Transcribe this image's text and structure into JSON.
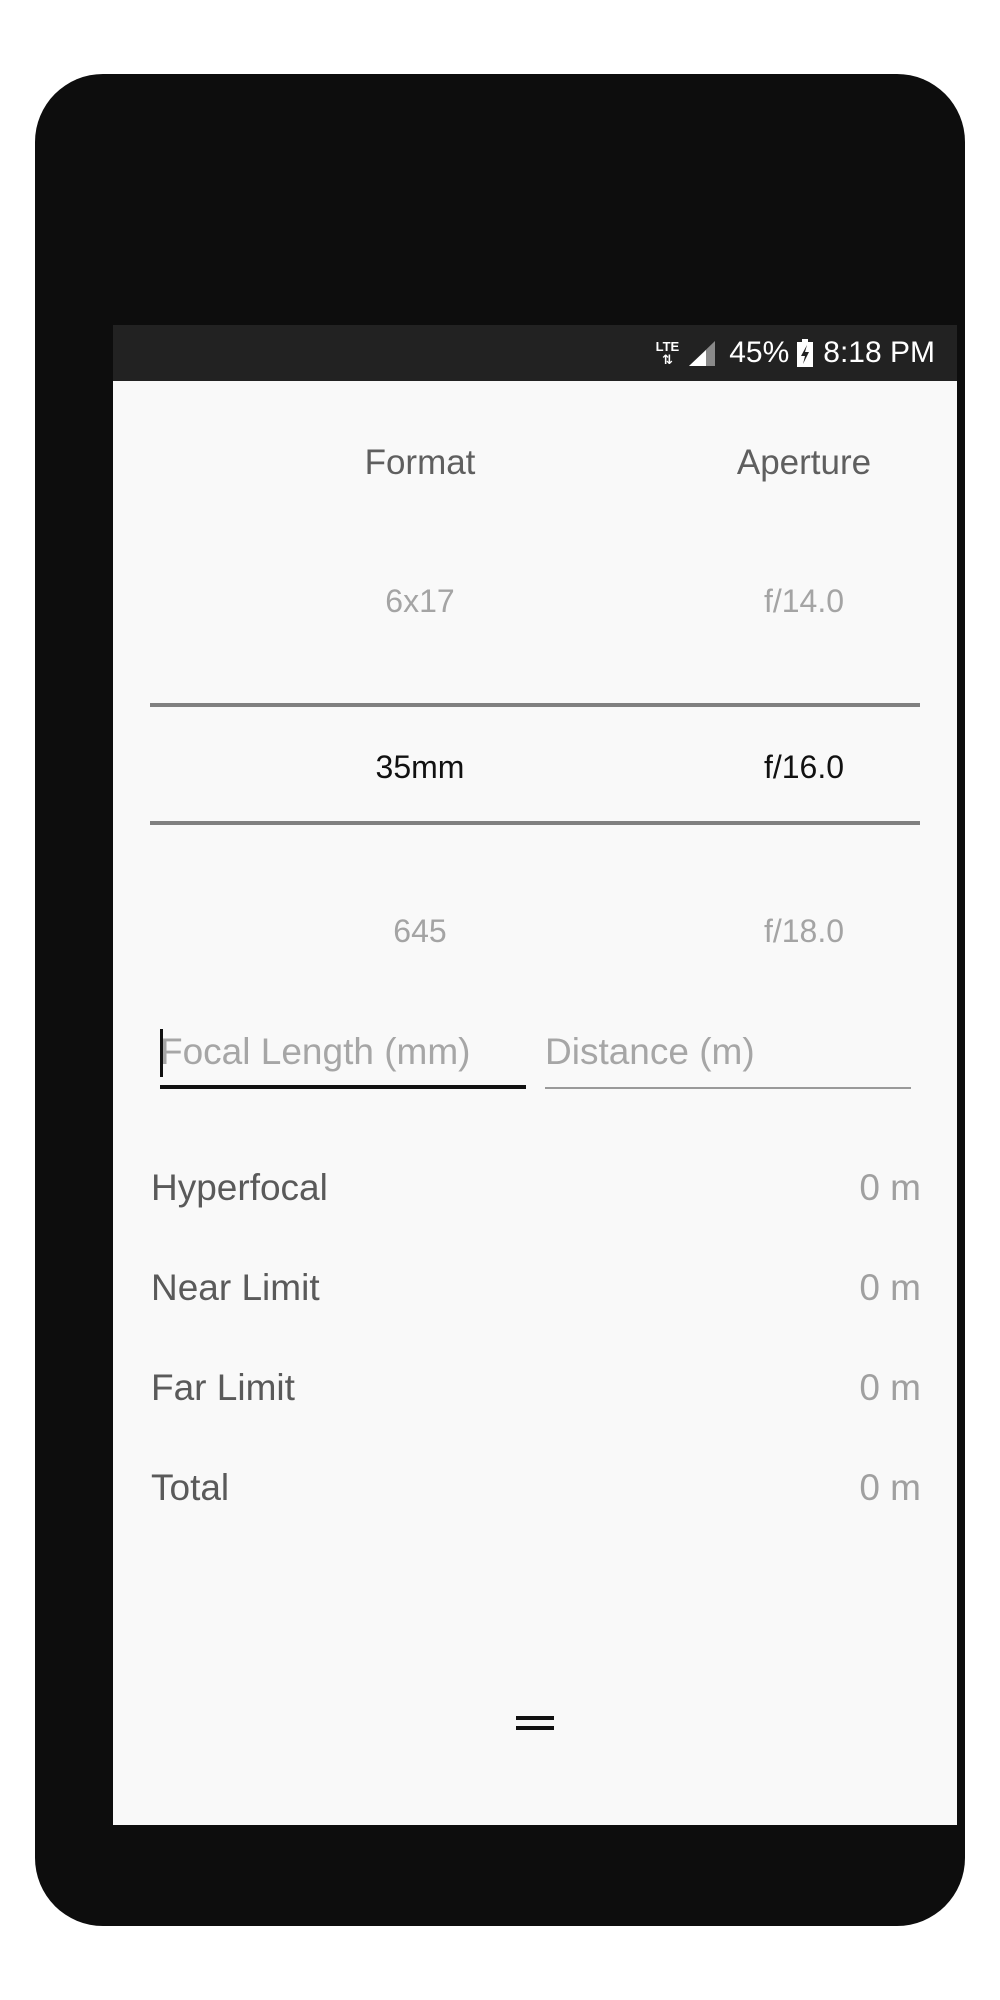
{
  "status_bar": {
    "network": "LTE",
    "battery_percent": "45%",
    "time": "8:18 PM"
  },
  "pickers": {
    "format": {
      "header": "Format",
      "above": "6x17",
      "selected": "35mm",
      "below": "645"
    },
    "aperture": {
      "header": "Aperture",
      "above": "f/14.0",
      "selected": "f/16.0",
      "below": "f/18.0"
    }
  },
  "inputs": {
    "focal_length": {
      "placeholder": "Focal Length (mm)",
      "value": ""
    },
    "distance": {
      "placeholder": "Distance (m)",
      "value": ""
    }
  },
  "results": [
    {
      "label": "Hyperfocal",
      "value": "0 m"
    },
    {
      "label": "Near Limit",
      "value": "0 m"
    },
    {
      "label": "Far Limit",
      "value": "0 m"
    },
    {
      "label": "Total",
      "value": "0 m"
    }
  ],
  "icons": {
    "signal": "signal-icon",
    "battery": "battery-charging-icon",
    "handle": "drag-handle-icon"
  }
}
